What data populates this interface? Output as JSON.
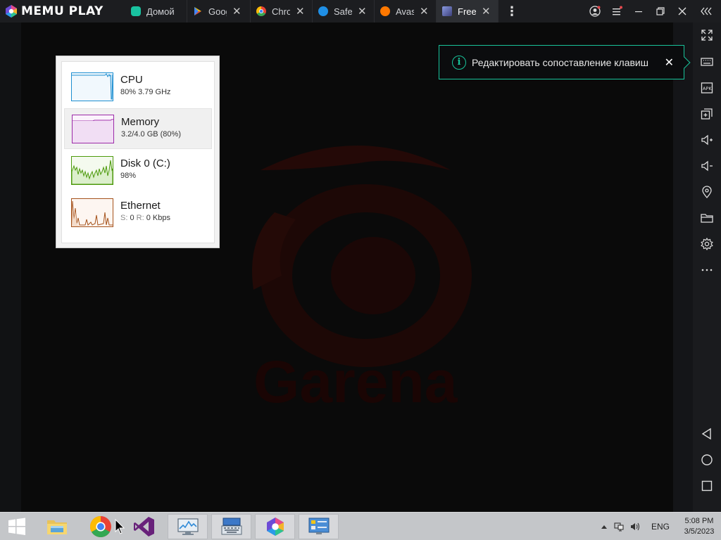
{
  "app": {
    "brand": "MEMU PLAY"
  },
  "tabs": [
    {
      "label": "Домой",
      "icon": "memu-home-icon",
      "color": "#19c2a0",
      "active": false,
      "closable": false
    },
    {
      "label": "Goog",
      "icon": "google-play-icon",
      "color": "#34a853",
      "active": false,
      "closable": true
    },
    {
      "label": "Chro",
      "icon": "chrome-icon",
      "color": "#ea4335",
      "active": false,
      "closable": true
    },
    {
      "label": "Safe",
      "icon": "safe-browser-icon",
      "color": "#1f8fe5",
      "active": false,
      "closable": true
    },
    {
      "label": "Avas",
      "icon": "avast-icon",
      "color": "#ff7800",
      "active": false,
      "closable": true
    },
    {
      "label": "Free",
      "icon": "free-fire-icon",
      "color": "#6b7ac9",
      "active": true,
      "closable": true
    }
  ],
  "tooltip": {
    "text": "Редактировать сопоставление клавиш"
  },
  "performance": {
    "rows": [
      {
        "name": "CPU",
        "detail": "80% 3.79 GHz",
        "color": "#1e8fd1",
        "selected": false
      },
      {
        "name": "Memory",
        "detail": "3.2/4.0 GB (80%)",
        "color": "#9c2aa8",
        "selected": true
      },
      {
        "name": "Disk 0 (C:)",
        "detail": "98%",
        "color": "#4d9a0c",
        "selected": false
      },
      {
        "name": "Ethernet",
        "detail_s_label": "S:",
        "detail_s": "0",
        "detail_r_label": "R:",
        "detail_r": "0 Kbps",
        "color": "#a5521b",
        "selected": false
      }
    ]
  },
  "background": {
    "watermark": "Garena"
  },
  "taskbar": {
    "language": "ENG",
    "time": "5:08 PM",
    "date": "3/5/2023"
  }
}
